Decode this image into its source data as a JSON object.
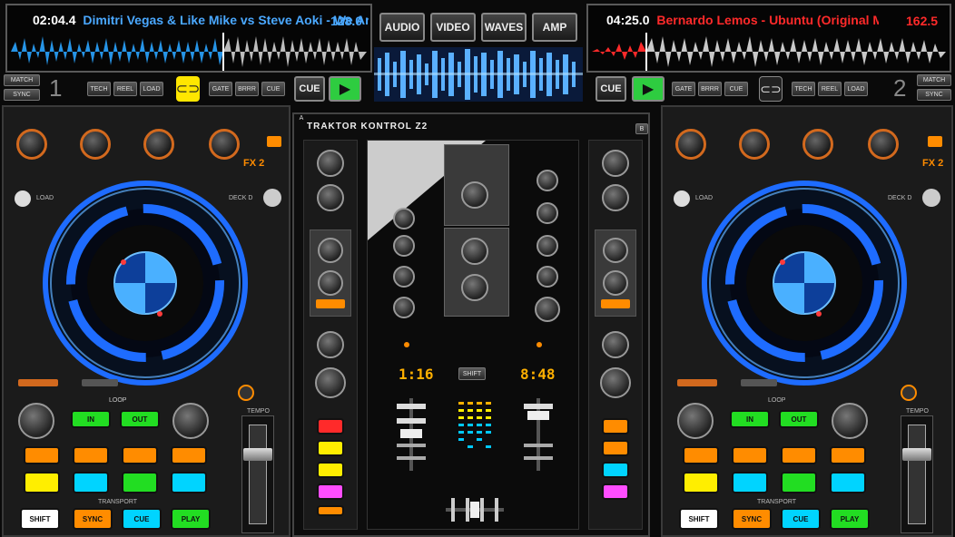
{
  "deck1": {
    "time": "02:04.4",
    "track": "Dimitri Vegas & Like Mike vs Steve Aoki - We Are Legenc",
    "bpm": "128.0",
    "number": "1",
    "buttons": {
      "cue": "CUE",
      "play": "▶",
      "shift": "SHIFT",
      "sync": "SYNC",
      "cue_pad": "CUE",
      "play_pad": "PLAY",
      "fx": "FX 2",
      "deck_label": "DECK D",
      "load": "LOAD",
      "tempo": "TEMPO",
      "transport": "TRANSPORT",
      "loop": "LOOP",
      "in": "IN",
      "out": "OUT"
    },
    "side_labels": [
      "MATCH",
      "SYNC"
    ],
    "small_buttons": [
      "TECH",
      "REEL",
      "LOAD"
    ],
    "loop_buttons": [
      "GATE",
      "BRRR",
      "CUE"
    ]
  },
  "deck2": {
    "time": "04:25.0",
    "track": "Bernardo Lemos - Ubuntu (Original Mix)",
    "bpm": "162.5",
    "number": "2",
    "buttons": {
      "cue": "CUE",
      "play": "▶",
      "shift": "SHIFT",
      "sync": "SYNC",
      "cue_pad": "CUE",
      "play_pad": "PLAY",
      "fx": "FX 2",
      "deck_label": "DECK D",
      "load": "LOAD",
      "tempo": "TEMPO",
      "transport": "TRANSPORT",
      "loop": "LOOP",
      "in": "IN",
      "out": "OUT"
    },
    "side_labels": [
      "MATCH",
      "SYNC"
    ],
    "small_buttons": [
      "TECH",
      "REEL",
      "LOAD"
    ],
    "loop_buttons": [
      "GATE",
      "BRRR",
      "CUE"
    ]
  },
  "top_tabs": [
    "AUDIO",
    "VIDEO",
    "WAVES",
    "AMP"
  ],
  "mixer": {
    "brand": "TRAKTOR KONTROL Z2",
    "display_left": "1:16",
    "display_right": "8:48",
    "shift": "SHIFT",
    "mode_left": "A",
    "mode_right": "B"
  },
  "colors": {
    "deck1_accent": "#1e90ff",
    "deck2_accent": "#ff2a2a",
    "platter_blue": "#1e6cff",
    "play_green": "#2ecc40",
    "pad_orange": "#ff8c00",
    "pad_yellow": "#ffee00",
    "pad_cyan": "#00d4ff",
    "pad_green": "#22dd22"
  }
}
